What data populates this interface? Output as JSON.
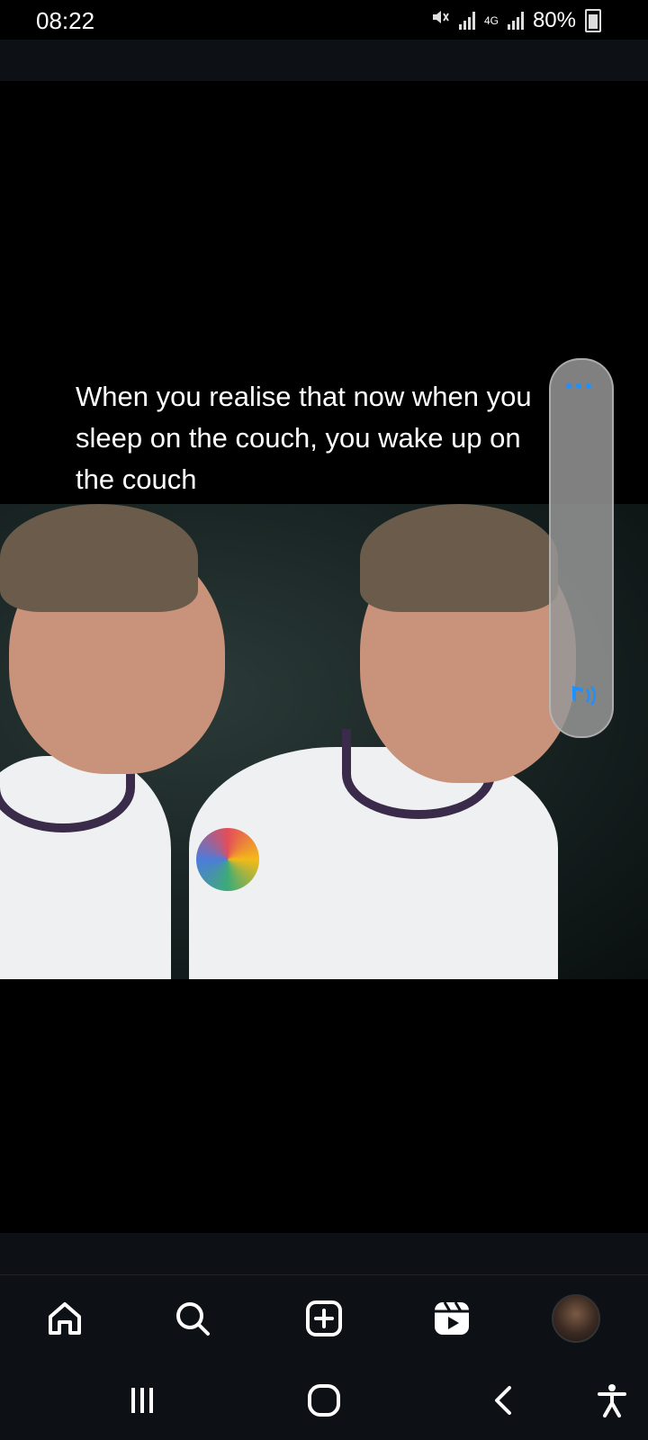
{
  "status_bar": {
    "time": "08:22",
    "network": "4G",
    "battery": "80%",
    "icons": [
      "mute-icon",
      "signal-icon",
      "network-4g-icon",
      "signal-icon",
      "battery-icon"
    ]
  },
  "video": {
    "caption": "When you realise that now when you sleep on the couch, you wake up on the couch"
  },
  "floating_pill": {
    "icons": [
      "more-options-icon",
      "audio-playing-icon"
    ],
    "accent_color": "#1e90ff"
  },
  "tab_bar": {
    "items": [
      {
        "icon": "home-icon"
      },
      {
        "icon": "search-icon"
      },
      {
        "icon": "create-post-icon"
      },
      {
        "icon": "reels-icon"
      },
      {
        "icon": "profile-avatar"
      }
    ]
  },
  "nav_bar": {
    "items": [
      {
        "icon": "recent-apps-icon"
      },
      {
        "icon": "home-circle-icon"
      },
      {
        "icon": "back-icon"
      },
      {
        "icon": "accessibility-icon"
      }
    ]
  },
  "colors": {
    "background": "#000000",
    "bar_background": "#0d1015"
  }
}
